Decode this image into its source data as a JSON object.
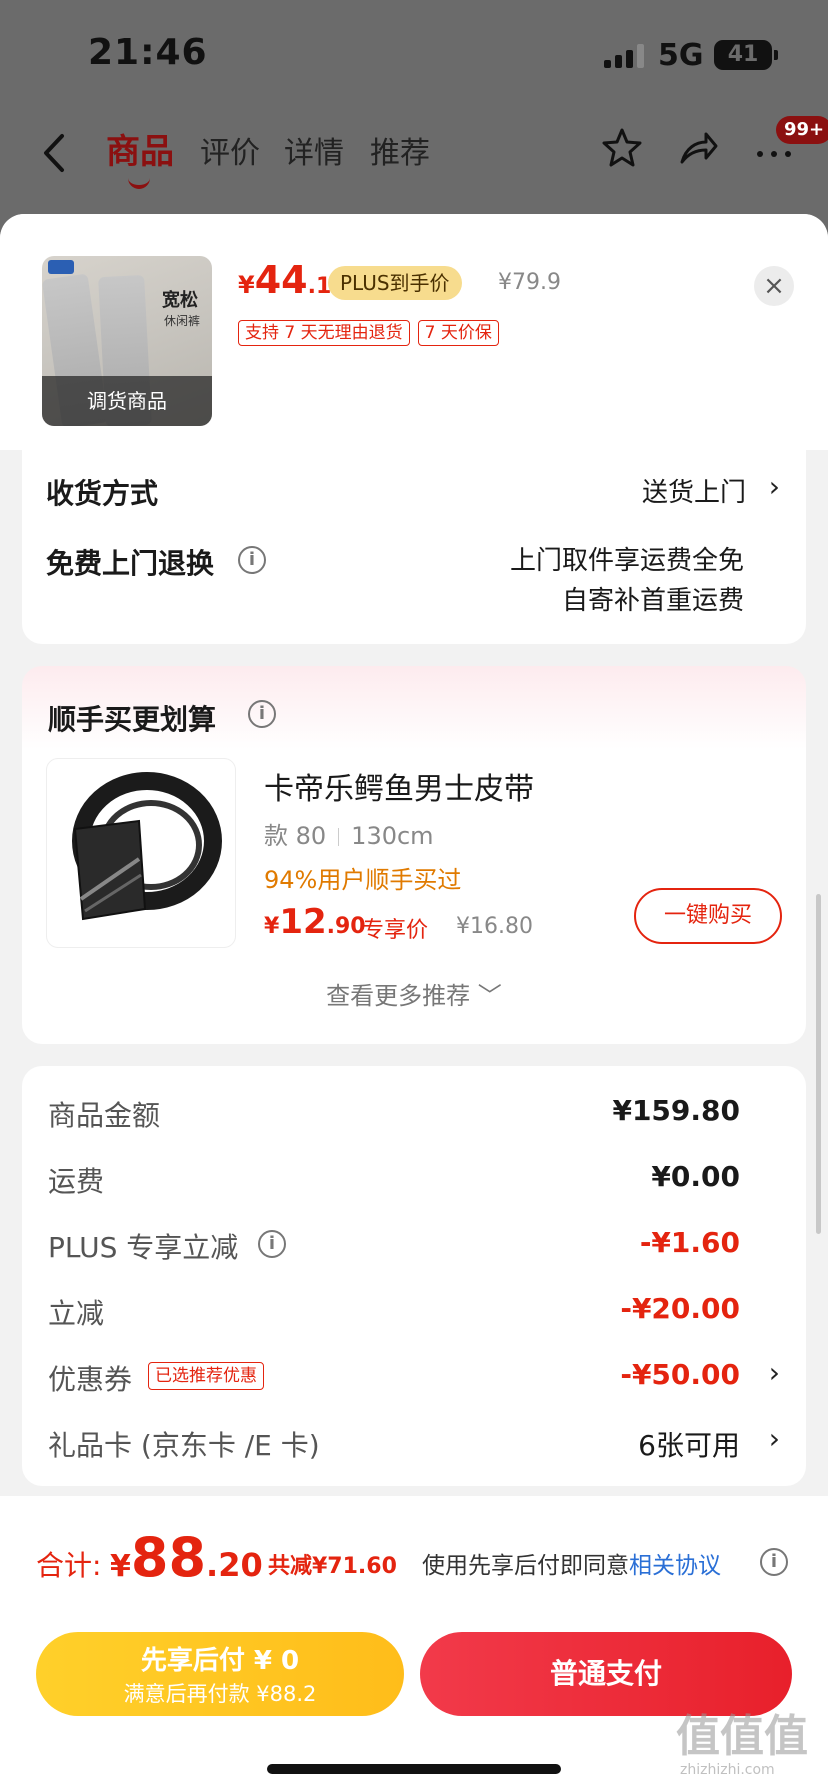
{
  "status": {
    "time": "21:46",
    "network": "5G",
    "battery": "41"
  },
  "nav": {
    "tabs": [
      "商品",
      "评价",
      "详情",
      "推荐"
    ],
    "badge": "99+"
  },
  "product": {
    "thumb_text1": "宽松",
    "thumb_text2": "休闲裤",
    "thumb_caption": "调货商品",
    "price_currency": "¥",
    "price_int": "44",
    "price_dec": ".1",
    "plus_label": "PLUS到手价",
    "orig_price": "¥79.9",
    "service_tags": [
      "支持 7 天无理由退货",
      "7 天价保"
    ],
    "close_glyph": "×"
  },
  "delivery": {
    "method_label": "收货方式",
    "method_value": "送货上门",
    "return_label": "免费上门退换",
    "return_line1": "上门取件享运费全免",
    "return_line2": "自寄补首重运费",
    "chevron": "›"
  },
  "recommend": {
    "title": "顺手买更划算",
    "item_name": "卡帝乐鳄鱼男士皮带",
    "spec_style": "款 80",
    "spec_size": "130cm",
    "stat": "94%用户顺手买过",
    "price_currency": "¥",
    "price_int": "12",
    "price_dec": ".90",
    "price_tag": "专享价",
    "orig_price": "¥16.80",
    "buy_label": "一键购买",
    "more_label": "查看更多推荐 ﹀"
  },
  "cost": {
    "rows": [
      {
        "label": "商品金额",
        "value": "¥159.80"
      },
      {
        "label": "运费",
        "value": "¥0.00"
      },
      {
        "label": "PLUS 专享立减",
        "value": "-¥1.60"
      },
      {
        "label": "立减",
        "value": "-¥20.00"
      },
      {
        "label": "优惠券",
        "value": "-¥50.00",
        "tag": "已选推荐优惠"
      },
      {
        "label": "礼品卡 (京东卡 /E 卡)",
        "value": "6张可用"
      }
    ]
  },
  "footer": {
    "total_label": "合计:",
    "total_currency": "¥",
    "total_int": "88",
    "total_dec": ".20",
    "total_save": "共减¥71.60",
    "agree_text": "使用先享后付即同意",
    "agree_link": "相关协议",
    "later_l1": "先享后付 ¥ 0",
    "later_l2": "满意后再付款 ¥88.2",
    "pay_label": "普通支付"
  },
  "watermark": {
    "main": "值值值",
    "sub": "zhizhizhi.com"
  },
  "colors": {
    "accent": "#e4240f",
    "plus_gold": "#f7dc8e",
    "later_yellow": "#ffc623",
    "pay_red": "#ec2a35",
    "link_blue": "#2a6fd6"
  }
}
